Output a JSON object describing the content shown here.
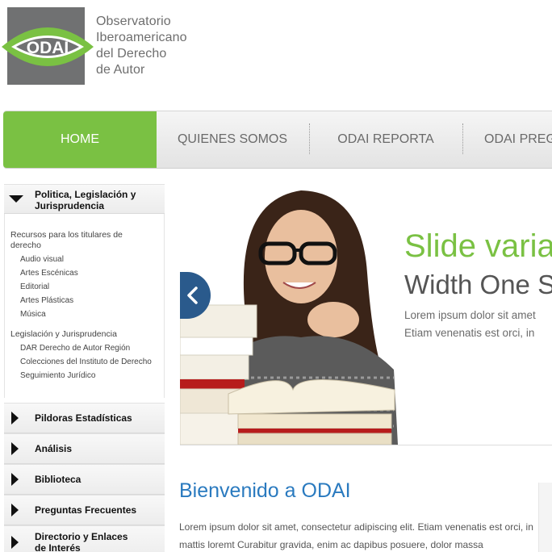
{
  "logo": {
    "mark": "ODAI",
    "lines": [
      "Observatorio",
      "Iberoamericano",
      "del Derecho",
      "de Autor"
    ],
    "colors": {
      "box": "#707172",
      "eye": "#7ac143"
    }
  },
  "nav": {
    "items": [
      "HOME",
      "QUIENES SOMOS",
      "ODAI REPORTA",
      "ODAI PREG"
    ],
    "active": "HOME",
    "accent": "#7ac143"
  },
  "sidebar": {
    "open_section": {
      "label": "Politica, Legislación y Jurisprudencia",
      "groups": [
        {
          "title": "Recursos para los titulares de derecho",
          "links": [
            "Audio visual",
            "Artes Escénicas",
            "Editorial",
            "Artes Plásticas",
            "Música"
          ]
        },
        {
          "title": "Legislación y Jurisprudencia",
          "links": [
            "DAR Derecho de Autor Región",
            "Colecciones del Instituto de Derecho",
            "Seguimiento Jurídico"
          ]
        }
      ]
    },
    "sections": [
      "Pildoras Estadísticas",
      "Análisis",
      "Biblioteca",
      "Preguntas Frecuentes",
      "Directorio y Enlaces de Interés"
    ]
  },
  "slider": {
    "title": "Slide varia",
    "subtitle": "Width One S",
    "text_lines": [
      "Lorem ipsum dolor sit amet",
      "Etiam venenatis est orci, in"
    ],
    "prev_icon": "chevron-left-icon"
  },
  "welcome": {
    "title": "Bienvenido a ODAI",
    "text": "Lorem ipsum dolor sit amet, consectetur adipiscing elit. Etiam venenatis est orci, in mattis loremt Curabitur gravida, enim ac dapibus posuere, dolor massa"
  }
}
